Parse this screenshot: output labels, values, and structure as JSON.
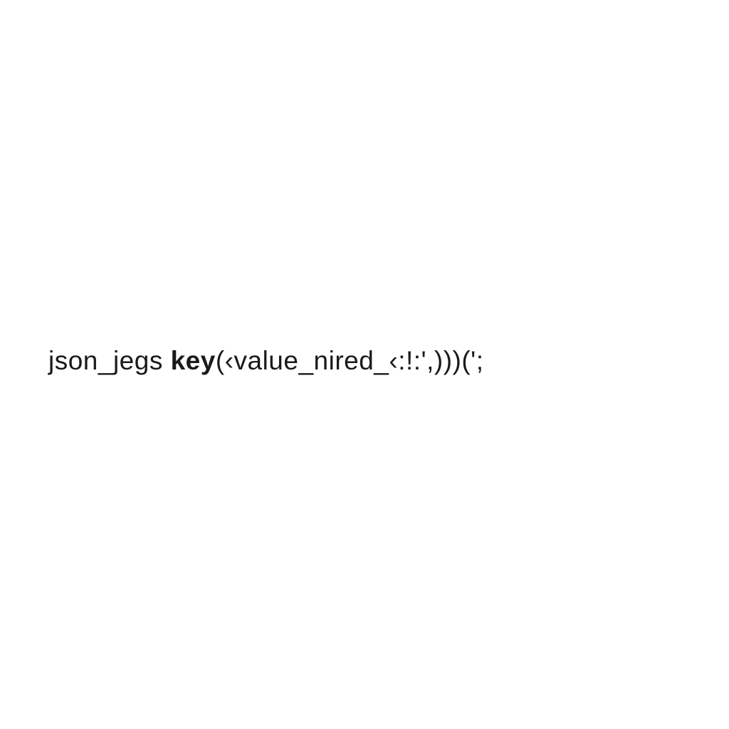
{
  "code": {
    "segment1": "json_jegs ",
    "segment2": "key",
    "segment3": "(‹value_nired_‹:!:',)))(';"
  }
}
